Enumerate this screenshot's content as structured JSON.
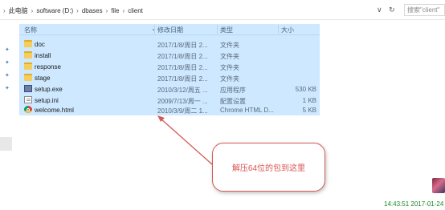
{
  "address_bar": {
    "breadcrumbs": [
      "此电脑",
      "software (D:)",
      "dbases",
      "file",
      "client"
    ],
    "back_arrow": "›",
    "dropdown_glyph": "∨",
    "refresh_glyph": "↻",
    "search_placeholder": "搜索\"client\""
  },
  "columns": {
    "name": "名称",
    "date": "修改日期",
    "type": "类型",
    "size": "大小"
  },
  "files": [
    {
      "name": "doc",
      "date": "2017/1/8/周日 2...",
      "type": "文件夹",
      "size": "",
      "icon": "folder-icon"
    },
    {
      "name": "install",
      "date": "2017/1/8/周日 2...",
      "type": "文件夹",
      "size": "",
      "icon": "folder-icon"
    },
    {
      "name": "response",
      "date": "2017/1/8/周日 2...",
      "type": "文件夹",
      "size": "",
      "icon": "folder-icon"
    },
    {
      "name": "stage",
      "date": "2017/1/8/周日 2...",
      "type": "文件夹",
      "size": "",
      "icon": "folder-icon"
    },
    {
      "name": "setup.exe",
      "date": "2010/3/12/周五 ...",
      "type": "应用程序",
      "size": "530 KB",
      "icon": "exe-icon"
    },
    {
      "name": "setup.ini",
      "date": "2009/7/13/周一 ...",
      "type": "配置设置",
      "size": "1 KB",
      "icon": "ini-icon"
    },
    {
      "name": "welcome.html",
      "date": "2010/3/9/周二 1...",
      "type": "Chrome HTML D...",
      "size": "5 KB",
      "icon": "chrome-icon"
    }
  ],
  "annotation": {
    "text": "解压64位的包到这里",
    "color": "#d35b57"
  },
  "timestamp": "14:43:51 2017-01-24",
  "colors": {
    "selection": "#cde8ff",
    "timestamp": "#1d8a2c"
  }
}
